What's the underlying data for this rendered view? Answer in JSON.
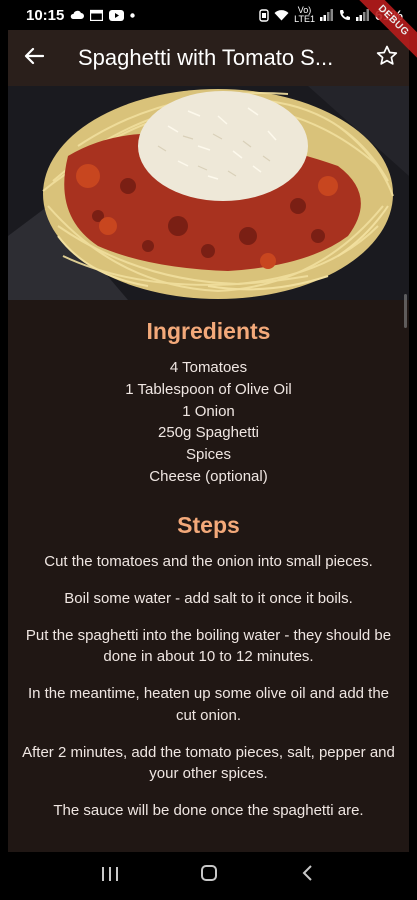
{
  "status_bar": {
    "time": "10:15",
    "net_top": "Vo)",
    "net_bottom": "LTE1",
    "battery": "61%"
  },
  "debug_banner": "DEBUG",
  "app_bar": {
    "title": "Spaghetti with Tomato S...",
    "back_icon": "arrow-left-icon",
    "favorite_icon": "star-outline-icon"
  },
  "recipe": {
    "ingredients_title": "Ingredients",
    "ingredients": [
      "4 Tomatoes",
      "1 Tablespoon of Olive Oil",
      "1 Onion",
      "250g Spaghetti",
      "Spices",
      "Cheese (optional)"
    ],
    "steps_title": "Steps",
    "steps": [
      "Cut the tomatoes and the onion into small pieces.",
      "Boil some water - add salt to it once it boils.",
      "Put the spaghetti into the boiling water - they should be done in about 10 to 12 minutes.",
      "In the meantime, heaten up some olive oil and add the cut onion.",
      "After 2 minutes, add the tomato pieces, salt, pepper and your other spices.",
      "The sauce will be done once the spaghetti are."
    ]
  },
  "nav_bar": {
    "recents_icon": "recents-icon",
    "home_icon": "home-icon",
    "back_icon": "back-chevron-icon"
  },
  "colors": {
    "app_bar": "#2a1f1b",
    "background": "#201714",
    "accent": "#f3a97a",
    "text": "#efe6e2"
  }
}
